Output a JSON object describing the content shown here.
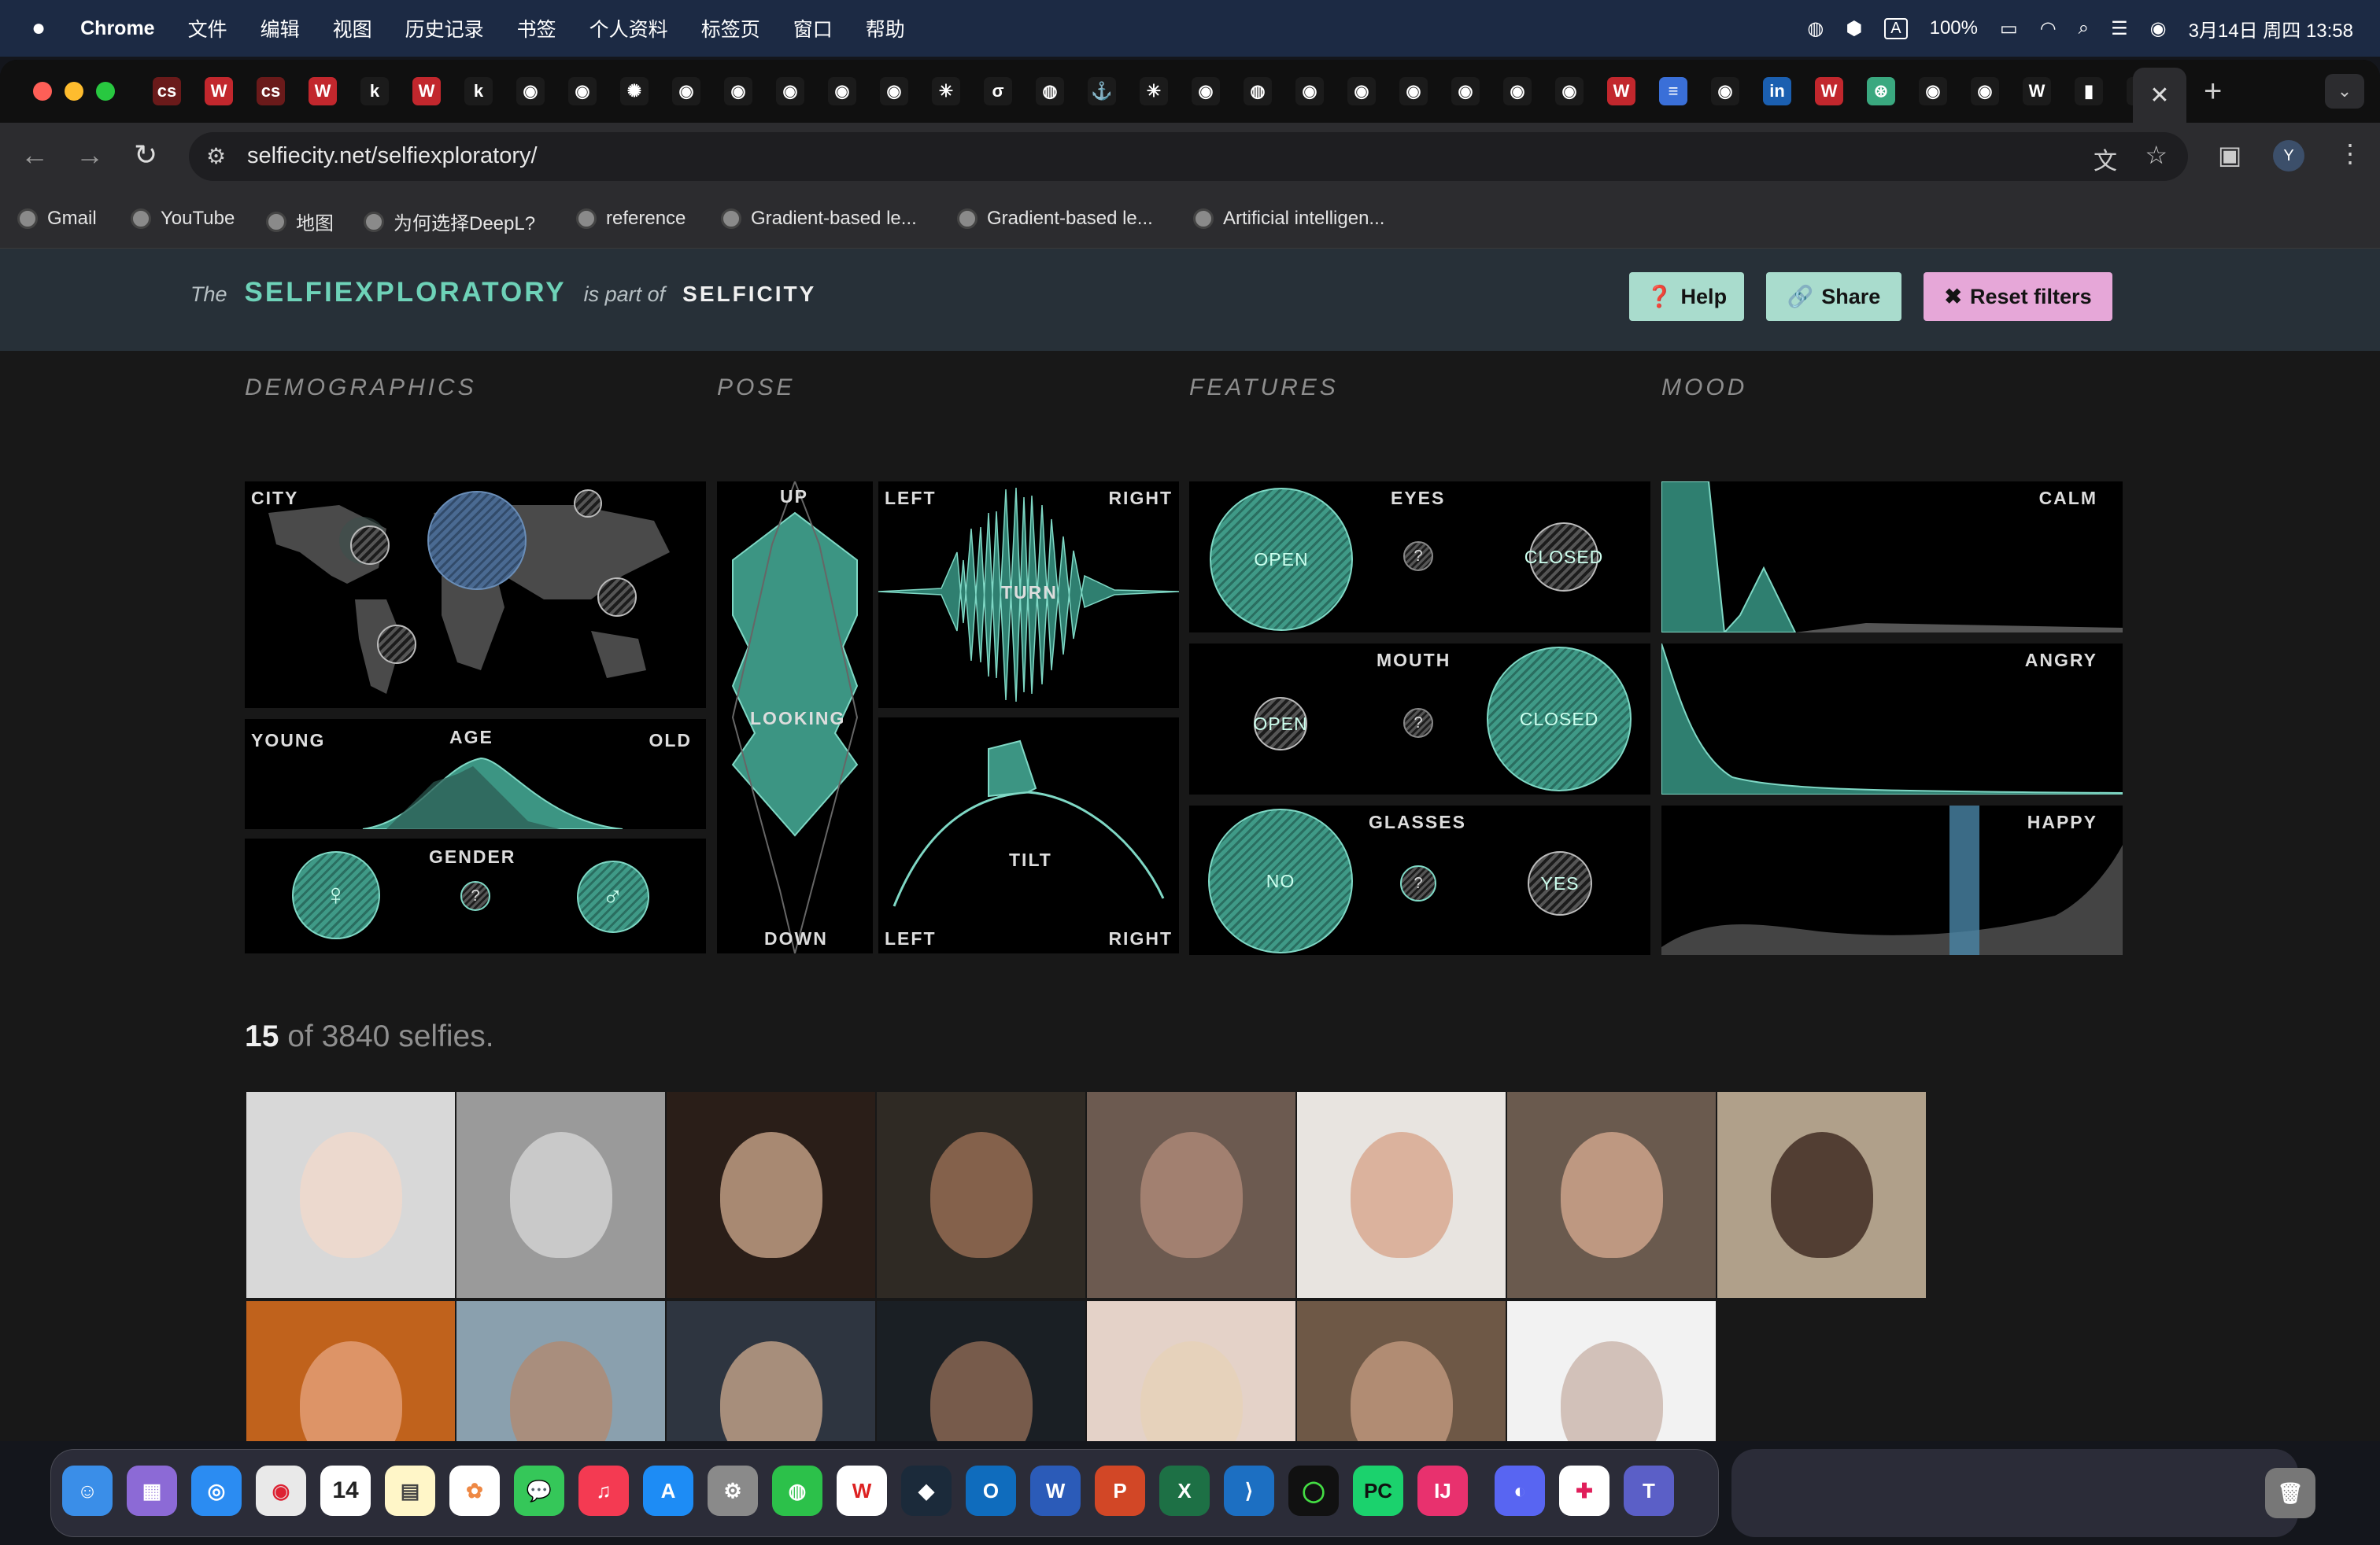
{
  "menubar": {
    "app": "Chrome",
    "menus": [
      "文件",
      "编辑",
      "视图",
      "历史记录",
      "书签",
      "个人资料",
      "标签页",
      "窗口",
      "帮助"
    ],
    "battery": "100%",
    "datetime": "3月14日 周四  13:58"
  },
  "browser": {
    "tabs": [
      {
        "icon": "cs-icon",
        "text": "cs",
        "color": "#6a1a1a"
      },
      {
        "icon": "w-icon",
        "text": "W",
        "color": "#c2272d"
      },
      {
        "icon": "cs-icon",
        "text": "cs",
        "color": "#6a1a1a"
      },
      {
        "icon": "w-icon",
        "text": "W",
        "color": "#c2272d"
      },
      {
        "icon": "k-icon",
        "text": "k",
        "color": "#1b1b1b"
      },
      {
        "icon": "w-icon",
        "text": "W",
        "color": "#c2272d"
      },
      {
        "icon": "k-icon",
        "text": "k",
        "color": "#1b1b1b"
      },
      {
        "icon": "github-icon",
        "text": "◉",
        "color": "#1b1b1b"
      },
      {
        "icon": "github-icon",
        "text": "◉",
        "color": "#1b1b1b"
      },
      {
        "icon": "spark-icon",
        "text": "✺",
        "color": "#1b1b1b"
      },
      {
        "icon": "github-icon",
        "text": "◉",
        "color": "#1b1b1b"
      },
      {
        "icon": "github-icon",
        "text": "◉",
        "color": "#1b1b1b"
      },
      {
        "icon": "github-icon",
        "text": "◉",
        "color": "#1b1b1b"
      },
      {
        "icon": "github-icon",
        "text": "◉",
        "color": "#1b1b1b"
      },
      {
        "icon": "github-icon",
        "text": "◉",
        "color": "#1b1b1b"
      },
      {
        "icon": "asterisk-icon",
        "text": "✳",
        "color": "#1b1b1b"
      },
      {
        "icon": "sigma-icon",
        "text": "σ",
        "color": "#1b1b1b"
      },
      {
        "icon": "globe-icon",
        "text": "◍",
        "color": "#1b1b1b"
      },
      {
        "icon": "anchor-icon",
        "text": "⚓",
        "color": "#1b1b1b"
      },
      {
        "icon": "asterisk-icon",
        "text": "✳",
        "color": "#1b1b1b"
      },
      {
        "icon": "github-icon",
        "text": "◉",
        "color": "#1b1b1b"
      },
      {
        "icon": "globe-icon",
        "text": "◍",
        "color": "#1b1b1b"
      },
      {
        "icon": "github-icon",
        "text": "◉",
        "color": "#1b1b1b"
      },
      {
        "icon": "github-icon",
        "text": "◉",
        "color": "#1b1b1b"
      },
      {
        "icon": "github-icon",
        "text": "◉",
        "color": "#1b1b1b"
      },
      {
        "icon": "github-icon",
        "text": "◉",
        "color": "#1b1b1b"
      },
      {
        "icon": "github-icon",
        "text": "◉",
        "color": "#1b1b1b"
      },
      {
        "icon": "github-icon",
        "text": "◉",
        "color": "#1b1b1b"
      },
      {
        "icon": "w-icon",
        "text": "W",
        "color": "#c2272d"
      },
      {
        "icon": "docs-icon",
        "text": "≡",
        "color": "#3a6fd8"
      },
      {
        "icon": "github-icon",
        "text": "◉",
        "color": "#1b1b1b"
      },
      {
        "icon": "linkedin-icon",
        "text": "in",
        "color": "#1b5fb0"
      },
      {
        "icon": "w-icon",
        "text": "W",
        "color": "#c2272d"
      },
      {
        "icon": "chatgpt-icon",
        "text": "⊛",
        "color": "#3aa87f"
      },
      {
        "icon": "github-icon",
        "text": "◉",
        "color": "#1b1b1b"
      },
      {
        "icon": "github-icon",
        "text": "◉",
        "color": "#1b1b1b"
      },
      {
        "icon": "w-icon",
        "text": "W",
        "color": "#1b1b1b"
      },
      {
        "icon": "bar-chart-icon",
        "text": "▮",
        "color": "#1b1b1b"
      },
      {
        "icon": "tools-icon",
        "text": "⚙",
        "color": "#1b1b1b"
      }
    ],
    "url": "selfiecity.net/selfiexploratory/",
    "bookmarks": [
      "Gmail",
      "YouTube",
      "地图",
      "为何选择DeepL?",
      "reference",
      "Gradient-based le...",
      "Gradient-based le...",
      "Artificial intelligen..."
    ],
    "profile": "Y"
  },
  "site": {
    "the": "The",
    "name": "SELFIEXPLORATORY",
    "part_of": "is part of",
    "parent": "SELFICITY",
    "help": "Help",
    "share": "Share",
    "reset": "Reset filters"
  },
  "sections": [
    "DEMOGRAPHICS",
    "POSE",
    "FEATURES",
    "MOOD"
  ],
  "panels": {
    "city": "CITY",
    "age": {
      "left": "YOUNG",
      "title": "AGE",
      "right": "OLD"
    },
    "gender": {
      "title": "GENDER",
      "female": "♀",
      "unknown": "?",
      "male": "♂"
    },
    "pose_vertical": {
      "top": "UP",
      "center": "LOOKING",
      "bottom": "DOWN"
    },
    "turn": {
      "left": "LEFT",
      "right": "RIGHT",
      "title": "TURN"
    },
    "tilt": {
      "title": "TILT",
      "left": "LEFT",
      "right": "RIGHT"
    },
    "eyes": {
      "title": "EYES",
      "open": "OPEN",
      "unknown": "?",
      "closed": "CLOSED"
    },
    "mouth": {
      "title": "MOUTH",
      "open": "OPEN",
      "unknown": "?",
      "closed": "CLOSED"
    },
    "glasses": {
      "title": "GLASSES",
      "no": "NO",
      "unknown": "?",
      "yes": "YES"
    },
    "calm": "CALM",
    "angry": "ANGRY",
    "happy": "HAPPY"
  },
  "results": {
    "count": "15",
    "suffix": "of 3840 selfies."
  },
  "selfies": [
    {
      "bg": "#d8d8d8",
      "face": "#f1d9cc"
    },
    {
      "bg": "#9a9a9a",
      "face": "#d5d5d5"
    },
    {
      "bg": "#2a1e18",
      "face": "#c8a48a"
    },
    {
      "bg": "#2f2a24",
      "face": "#9a6f55"
    },
    {
      "bg": "#6c5a50",
      "face": "#b08a78"
    },
    {
      "bg": "#e8e4e0",
      "face": "#d7a58c"
    },
    {
      "bg": "#6a5a4e",
      "face": "#d3a88e"
    },
    {
      "bg": "#b0a08a",
      "face": "#3b261d"
    },
    {
      "bg": "#c0621c",
      "face": "#e3a17a"
    },
    {
      "bg": "#8aa0ae",
      "face": "#b08a70"
    },
    {
      "bg": "#2e3540",
      "face": "#c5a58a"
    },
    {
      "bg": "#1a1f24",
      "face": "#8f6a55"
    },
    {
      "bg": "#e4d2c8",
      "face": "#e6d2b8"
    },
    {
      "bg": "#6e5846",
      "face": "#c29a7e"
    },
    {
      "bg": "#f2f2f2",
      "face": "#c9b4aa"
    }
  ]
}
